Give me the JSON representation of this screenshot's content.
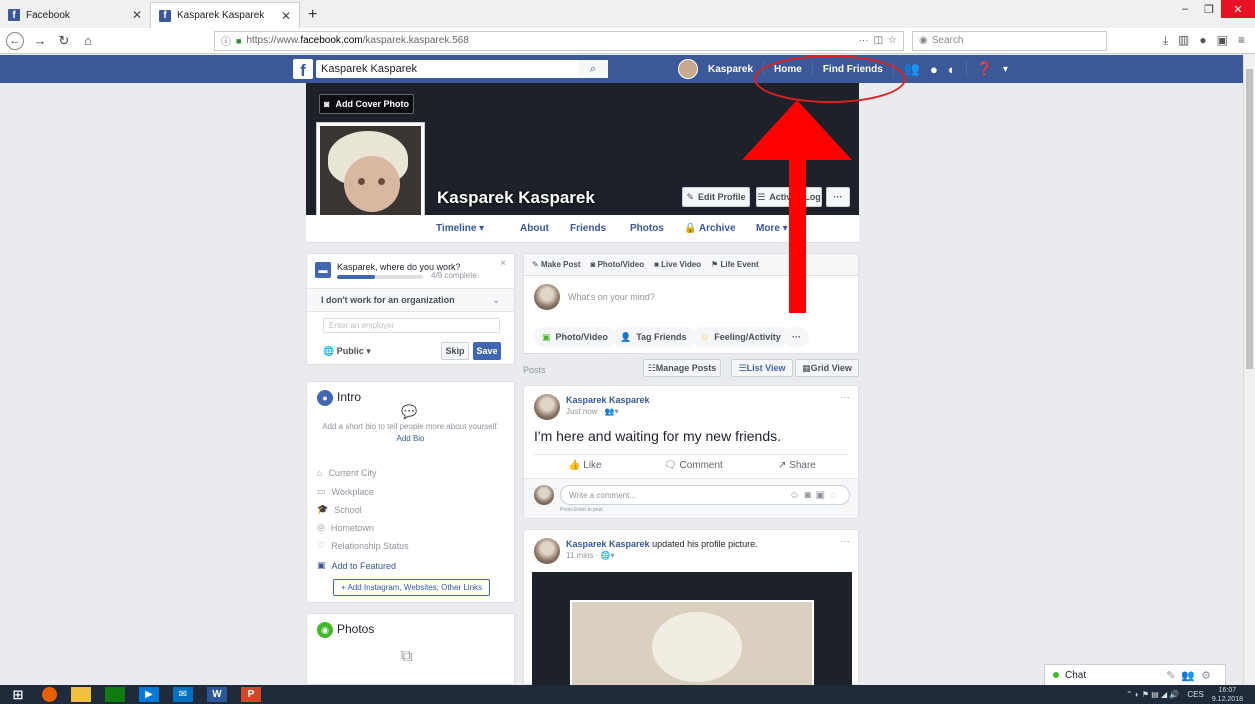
{
  "browser": {
    "tabs": [
      {
        "title": "Facebook",
        "close": "✕"
      },
      {
        "title": "Kasparek Kasparek",
        "close": "✕"
      }
    ],
    "new_tab": "+",
    "url_prefix": "https://www.",
    "url_domain": "facebook.com",
    "url_path": "/kasparek.kasparek.568",
    "url_dots": "···",
    "search_placeholder": "Search"
  },
  "fb": {
    "logo": "f",
    "search_value": "Kasparek Kasparek",
    "nav": {
      "user": "Kasparek",
      "home": "Home",
      "find_friends": "Find Friends"
    }
  },
  "profile": {
    "cover_button": "Add Cover Photo",
    "name": "Kasparek Kasparek",
    "edit_profile": "Edit Profile",
    "activity_log": "Activity Log",
    "more_dots": "···",
    "tabs": [
      "Timeline ▾",
      "About",
      "Friends",
      "Photos",
      "Archive",
      "More ▾"
    ]
  },
  "work_card": {
    "question": "Kasparek, where do you work?",
    "progress_text": "4/9 complete",
    "progress": 0.44,
    "select_value": "I don't work for an organization",
    "employer_placeholder": "Enter an employer",
    "privacy": "Public ▾",
    "skip": "Skip",
    "save": "Save"
  },
  "intro": {
    "title": "Intro",
    "bio_prompt": "Add a short bio to tell people more about yourself.",
    "add_bio": "Add Bio",
    "items": [
      "Current City",
      "Workplace",
      "School",
      "Hometown",
      "Relationship Status"
    ],
    "featured": "Add to Featured",
    "links_button": "+ Add Instagram, Websites, Other Links"
  },
  "photos_card": {
    "title": "Photos"
  },
  "composer": {
    "tabs": [
      "Make Post",
      "Photo/Video",
      "Live Video",
      "Life Event"
    ],
    "placeholder": "What's on your mind?",
    "actions": [
      "Photo/Video",
      "Tag Friends",
      "Feeling/Activity",
      "···"
    ]
  },
  "posts_bar": {
    "label": "Posts",
    "manage": "Manage Posts",
    "list_view": "List View",
    "grid_view": "Grid View"
  },
  "post1": {
    "author": "Kasparek Kasparek",
    "time": "Just now · ",
    "menu": "···",
    "text": "I'm here and waiting for my new friends.",
    "like": "Like",
    "comment": "Comment",
    "share": "Share",
    "comment_placeholder": "Write a comment...",
    "enter_hint": "Press Enter to post."
  },
  "post2": {
    "author": "Kasparek Kasparek",
    "action": " updated his profile picture.",
    "time": "11 mins · ",
    "menu": "···"
  },
  "chat": {
    "label": "Chat"
  },
  "tray": {
    "lang": "CES",
    "time": "16:07",
    "date": "9.12.2018"
  },
  "colors": {
    "fb_blue": "#3b5998",
    "link": "#365899",
    "annotation_red": "#ff0000"
  }
}
